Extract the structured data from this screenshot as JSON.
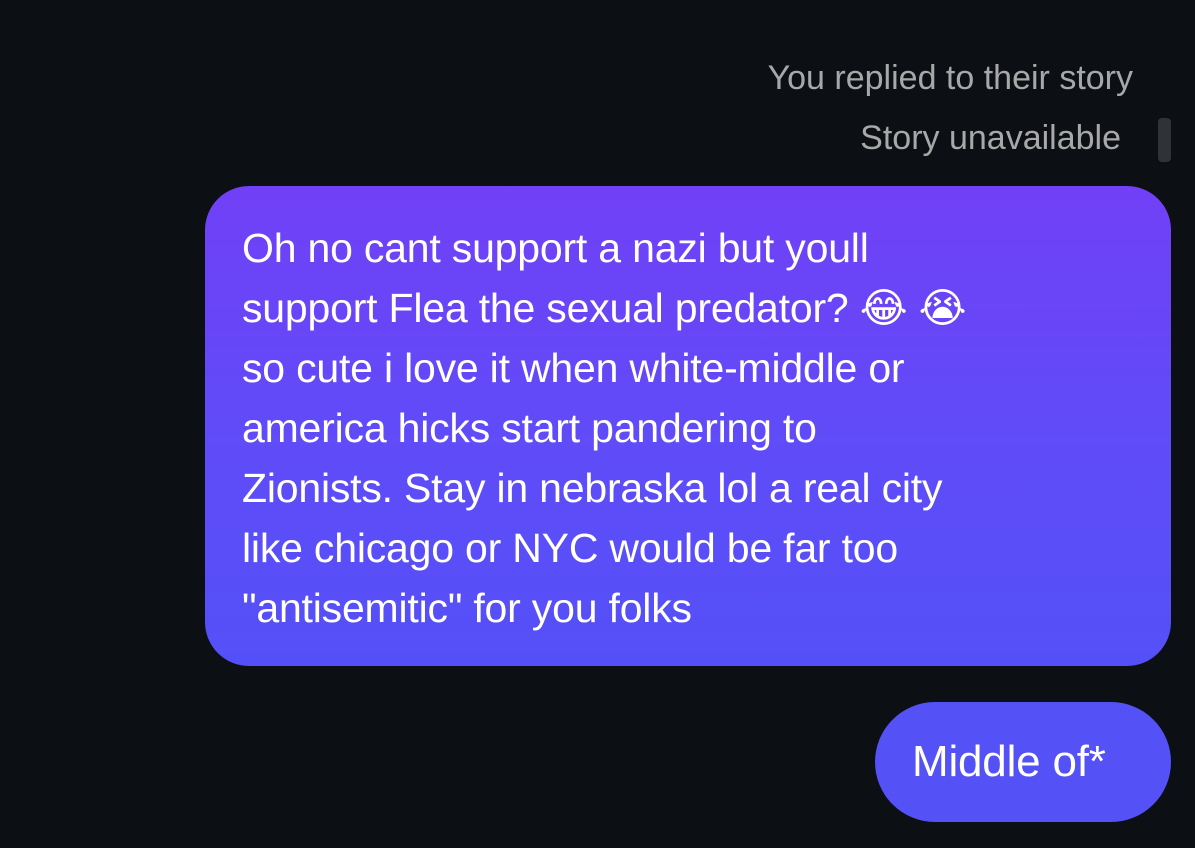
{
  "thread": {
    "reply_note": "You replied to their story",
    "story_note": "Story unavailable",
    "messages": [
      {
        "sender": "me",
        "text": "Oh no cant support a nazi but youll\nsupport Flea the sexual predator? 😂 😭\nso cute i love it when white-middle or\namerica hicks start pandering to\nZionists. Stay in nebraska lol a real city\nlike chicago or NYC would be far too\n\"antisemitic\" for you folks"
      },
      {
        "sender": "me",
        "text": "Middle of*"
      }
    ]
  },
  "colors": {
    "background": "#0c1014",
    "meta_text": "#a8a8a8",
    "bubble_top": "#7140f7",
    "bubble_bottom": "#5450f8"
  }
}
